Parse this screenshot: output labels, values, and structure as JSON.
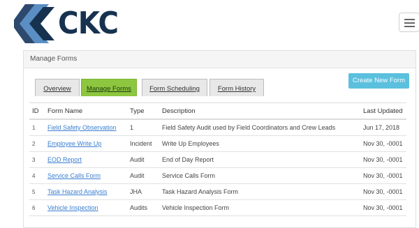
{
  "brand": {
    "logo_text": "CKC"
  },
  "nav": {
    "menu_icon": "hamburger-menu-icon"
  },
  "panel": {
    "title": "Manage Forms"
  },
  "tabs": [
    {
      "label": "Overview",
      "active": false
    },
    {
      "label": "Manage Forms",
      "active": true
    },
    {
      "label": "Form Scheduling",
      "active": false
    },
    {
      "label": "Form History",
      "active": false
    }
  ],
  "actions": {
    "create_label": "Create New Form"
  },
  "table": {
    "headers": {
      "id": "ID",
      "name": "Form Name",
      "type": "Type",
      "description": "Description",
      "updated": "Last Updated"
    },
    "rows": [
      {
        "id": "1",
        "name": "Field Safety Observation",
        "type": "1",
        "description": "Field Safety Audit used by Field Coordinators and Crew Leads",
        "updated": "Jun 17, 2018"
      },
      {
        "id": "2",
        "name": "Employee Write Up",
        "type": "Incident",
        "description": "Write Up Employees",
        "updated": "Nov 30, -0001"
      },
      {
        "id": "3",
        "name": "EOD Report",
        "type": "Audit",
        "description": "End of Day Report",
        "updated": "Nov 30, -0001"
      },
      {
        "id": "4",
        "name": "Service Calls Form",
        "type": "Audit",
        "description": "Service Calls Form",
        "updated": "Nov 30, -0001"
      },
      {
        "id": "5",
        "name": "Task Hazard Analysis",
        "type": "JHA",
        "description": "Task Hazard Analysis Form",
        "updated": "Nov 30, -0001"
      },
      {
        "id": "6",
        "name": "Vehicle Inspection",
        "type": "Audits",
        "description": "Vehicle Inspection Form",
        "updated": "Nov 30, -0001"
      }
    ]
  },
  "colors": {
    "brand_navy": "#17324f",
    "brand_blue": "#3b6ea5",
    "tab_active": "#8dc63f",
    "button": "#5bc0de",
    "link": "#3a7ed1"
  }
}
